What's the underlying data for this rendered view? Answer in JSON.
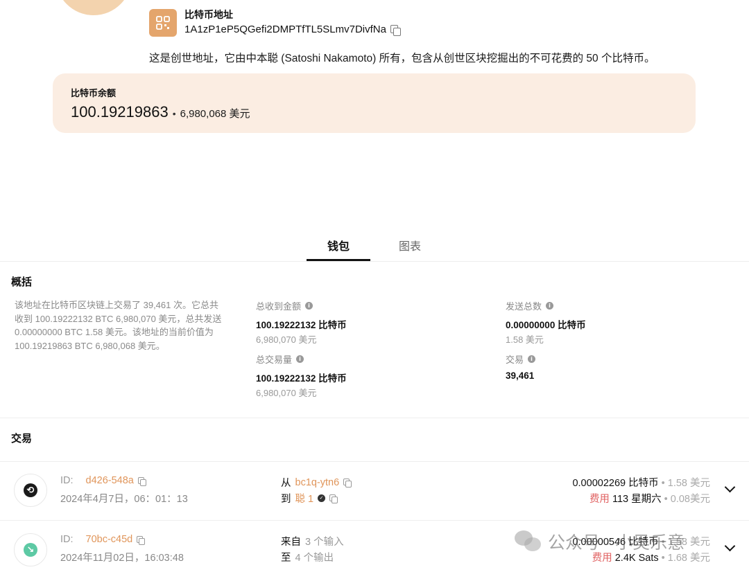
{
  "header": {
    "address_label": "比特币地址",
    "address_value": "1A1zP1eP5QGefi2DMPTfTL5SLmv7DivfNa",
    "description": "这是创世地址，它由中本聪 (Satoshi Nakamoto) 所有，包含从创世区块挖掘出的不可花费的 50 个比特币。"
  },
  "balance": {
    "label": "比特币余额",
    "btc": "100.19219863",
    "separator": "•",
    "usd": "6,980,068 美元"
  },
  "tabs": [
    {
      "label": "钱包",
      "active": true
    },
    {
      "label": "图表",
      "active": false
    }
  ],
  "overview": {
    "title": "概括",
    "text": "该地址在比特币区块链上交易了 39,461 次。它总共收到 100.19222132 BTC 6,980,070 美元，总共发送 0.00000000 BTC 1.58 美元。该地址的当前价值为 100.19219863 BTC 6,980,068 美元。",
    "stats": {
      "received": {
        "label": "总收到金额",
        "value": "100.19222132 比特币",
        "sub": "6,980,070 美元"
      },
      "sent": {
        "label": "发送总数",
        "value": "0.00000000 比特币",
        "sub": "1.58 美元"
      },
      "volume": {
        "label": "总交易量",
        "value": "100.19222132 比特币",
        "sub": "6,980,070 美元"
      },
      "txcount": {
        "label": "交易",
        "value": "39,461"
      }
    }
  },
  "transactions": {
    "title": "交易",
    "rows": [
      {
        "id_label": "ID:",
        "id": "d426-548a",
        "date": "2024年4月7日，06：01：13",
        "line1_prefix": "从",
        "line1_link": "bc1q-ytn6",
        "line2_prefix": "到",
        "line2_link": "聪 1",
        "amount": "0.00002269 比特币",
        "amount_sep": "•",
        "amount_usd": "1.58 美元",
        "fee_label": "费用",
        "fee_value": "113 星期六",
        "fee_sep": "•",
        "fee_usd": "0.08美元",
        "icon": "swap-icon",
        "icon_color": "#1a1a1a"
      },
      {
        "id_label": "ID:",
        "id": "70bc-c45d",
        "date": "2024年11月02日，16:03:48",
        "line1_prefix": "来自",
        "line1_muted": "3 个输入",
        "line2_prefix": "至",
        "line2_muted": "4 个输出",
        "amount": "0.00000546 比特币",
        "amount_sep": "•",
        "amount_usd": "1.58 美元",
        "fee_label": "费用",
        "fee_value": "2.4K Sats",
        "fee_sep": "•",
        "fee_usd": "1.68 美元",
        "icon": "arrow-down-right-icon",
        "icon_color": "#5dc9a4"
      }
    ]
  },
  "watermark": "公众号 · 小吴乐意",
  "colors": {
    "accent": "#e4a56c",
    "link": "#e0955a",
    "card_bg": "#fbede2",
    "fee": "#e06060"
  }
}
